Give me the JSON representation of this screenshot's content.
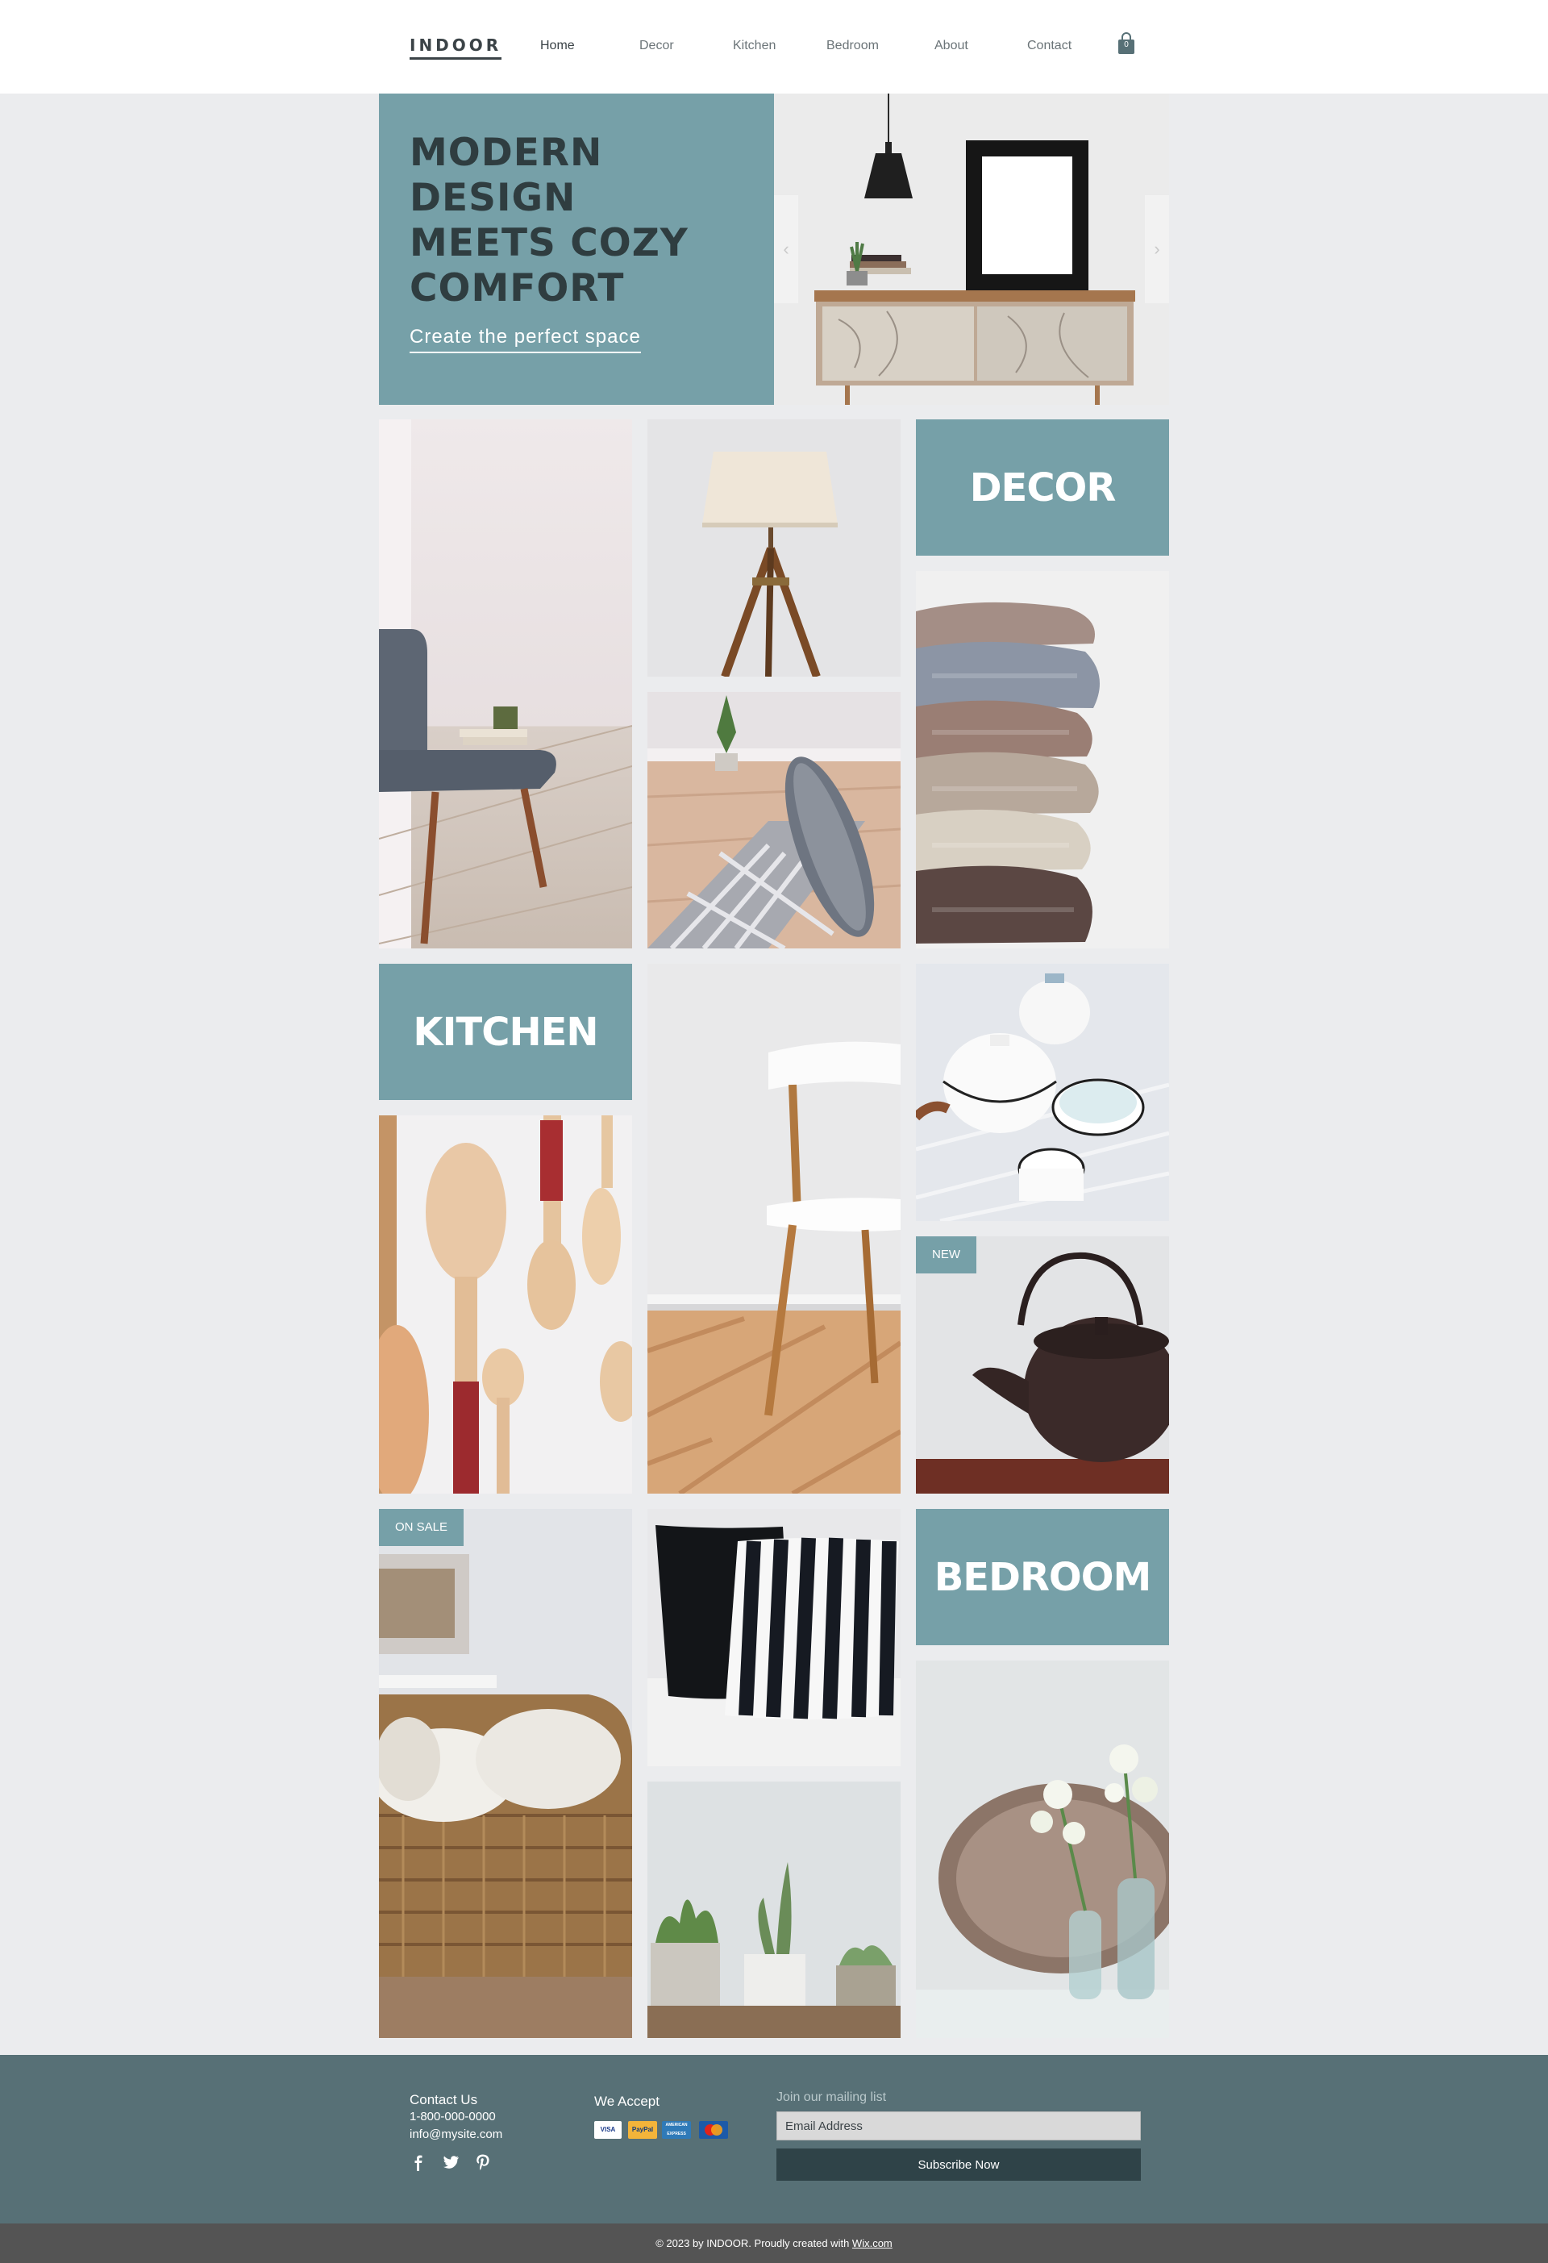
{
  "header": {
    "logo": "INDOOR",
    "nav": [
      "Home",
      "Decor",
      "Kitchen",
      "Bedroom",
      "About",
      "Contact"
    ],
    "cart_count": "0",
    "cart_icon": "shopping-bag-icon"
  },
  "hero": {
    "title": "MODERN\nDESIGN\nMEETS COZY\nCOMFORT",
    "link": "Create the perfect space",
    "prev_arrow": "‹",
    "next_arrow": "›",
    "image": "console-table-with-lamp-and-frame"
  },
  "categories": {
    "decor": "DECOR",
    "kitchen": "KITCHEN",
    "bedroom": "BEDROOM"
  },
  "badges": {
    "new": "NEW",
    "on_sale": "ON SALE"
  },
  "tiles": [
    "grey-chair",
    "tripod-lamp",
    "rolled-rug",
    "knit-blankets",
    "white-chair",
    "enamel-teapots",
    "wooden-spoons",
    "cast-iron-teapot",
    "wicker-basket-towels",
    "striped-pillows",
    "succulents",
    "flowers-and-tray"
  ],
  "footer": {
    "contact_heading": "Contact Us",
    "phone": "1-800-000-0000",
    "email": "info@mysite.com",
    "social": [
      "facebook-icon",
      "twitter-icon",
      "pinterest-icon"
    ],
    "accept_heading": "We Accept",
    "payments": [
      "VISA",
      "PayPal",
      "AMERICAN EXPRESS",
      "MasterCard"
    ],
    "mailing_label": "Join our mailing list",
    "email_placeholder": "Email Address",
    "subscribe": "Subscribe Now"
  },
  "copyright": {
    "text": "© 2023 by INDOOR. Proudly created with ",
    "link": "Wix.com"
  },
  "colors": {
    "accent": "#76a0a8",
    "footer": "#577076",
    "dark": "#3b4347",
    "background": "#ebecee"
  }
}
